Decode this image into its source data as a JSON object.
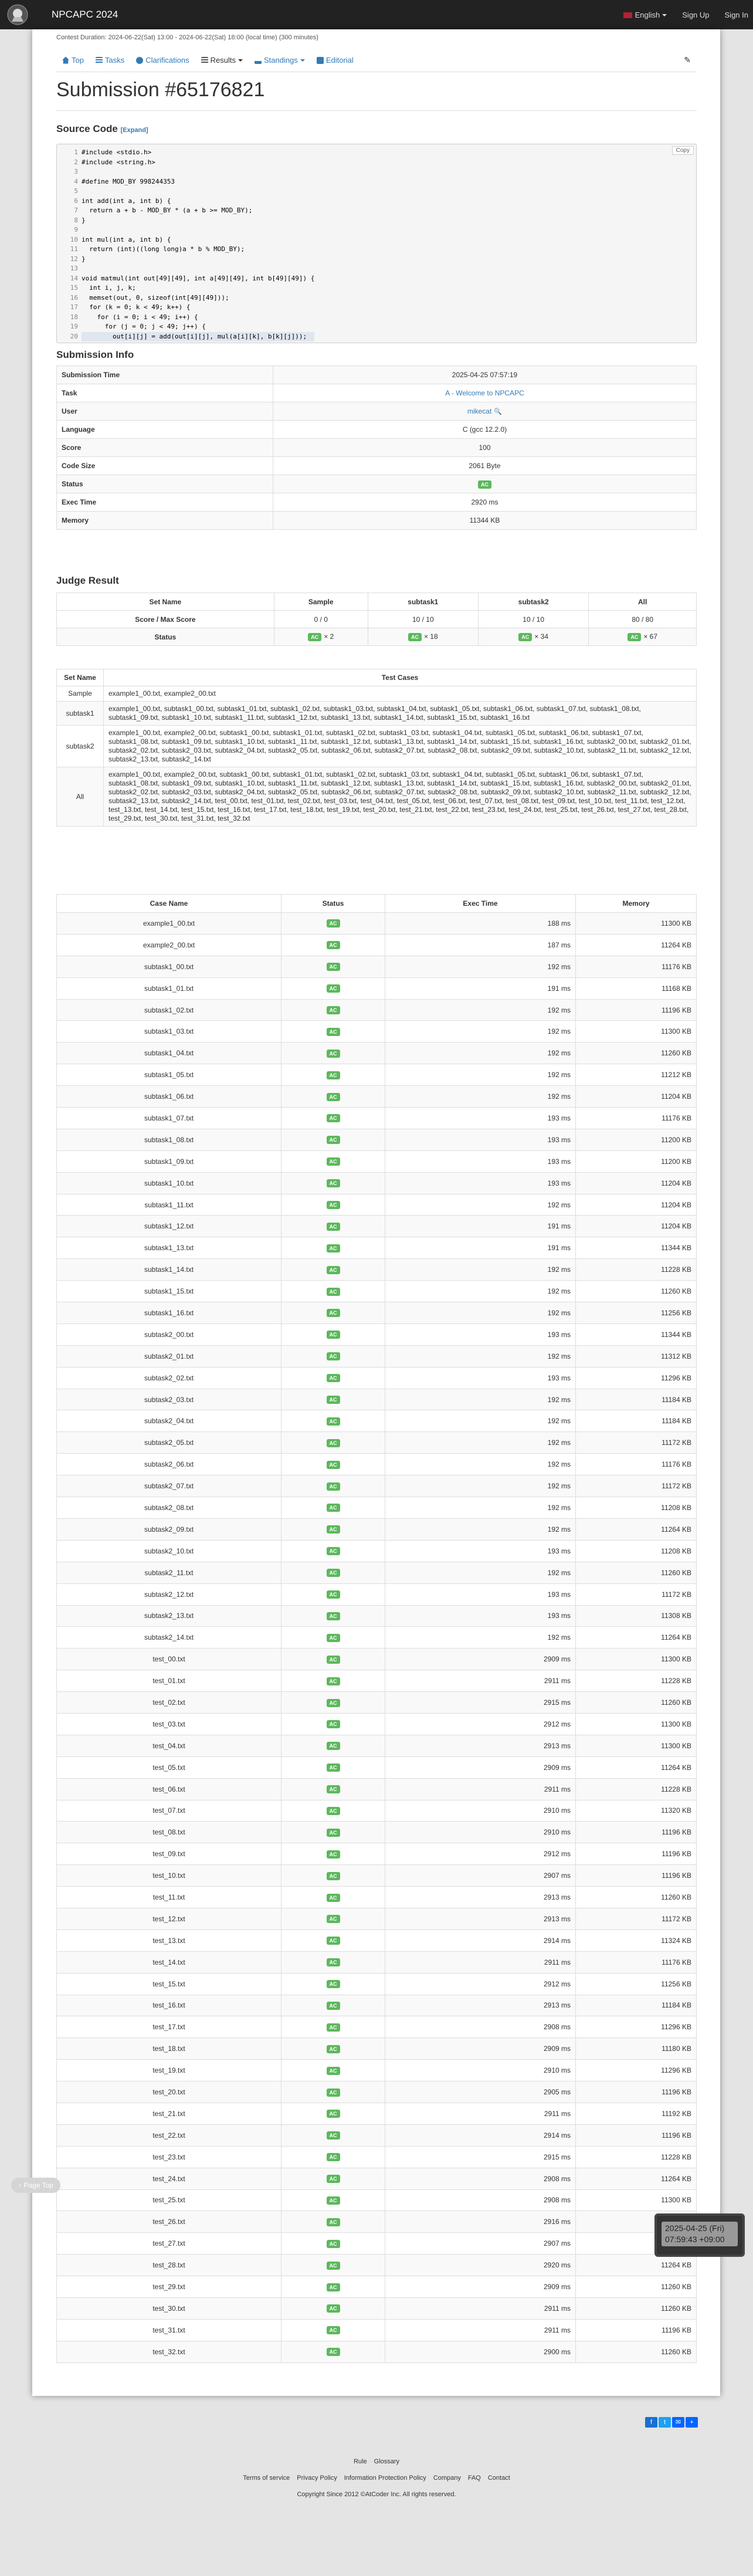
{
  "header": {
    "brand": "NPCAPC 2024",
    "language": "English",
    "sign_up": "Sign Up",
    "sign_in": "Sign In"
  },
  "contest_duration": "Contest Duration: 2024-06-22(Sat) 13:00 - 2024-06-22(Sat) 18:00 (local time) (300 minutes)",
  "tabs": {
    "top": "Top",
    "tasks": "Tasks",
    "clarifications": "Clarifications",
    "results": "Results",
    "standings": "Standings",
    "editorial": "Editorial"
  },
  "title": "Submission #65176821",
  "source": {
    "heading": "Source Code",
    "expand": "[Expand]",
    "copy": "Copy",
    "lines": [
      "#include <stdio.h>",
      "#include <string.h>",
      "",
      "#define MOD_BY 998244353",
      "",
      "int add(int a, int b) {",
      "  return a + b - MOD_BY * (a + b >= MOD_BY);",
      "}",
      "",
      "int mul(int a, int b) {",
      "  return (int)((long long)a * b % MOD_BY);",
      "}",
      "",
      "void matmul(int out[49][49], int a[49][49], int b[49][49]) {",
      "  int i, j, k;",
      "  memset(out, 0, sizeof(int[49][49]));",
      "  for (k = 0; k < 49; k++) {",
      "    for (i = 0; i < 49; i++) {",
      "      for (j = 0; j < 49; j++) {",
      "        out[i][j] = add(out[i][j], mul(a[i][k], b[k][j]));"
    ]
  },
  "info": {
    "heading": "Submission Info",
    "rows": [
      {
        "key": "Submission Time",
        "value": "2025-04-25 07:57:19"
      },
      {
        "key": "Task",
        "value": "A - Welcome to NPCAPC"
      },
      {
        "key": "User",
        "value": "mikecat"
      },
      {
        "key": "Language",
        "value": "C (gcc 12.2.0)"
      },
      {
        "key": "Score",
        "value": "100"
      },
      {
        "key": "Code Size",
        "value": "2061 Byte"
      },
      {
        "key": "Status",
        "value": "AC"
      },
      {
        "key": "Exec Time",
        "value": "2920 ms"
      },
      {
        "key": "Memory",
        "value": "11344 KB"
      }
    ]
  },
  "judge": {
    "heading": "Judge Result",
    "headers": [
      "Set Name",
      "Sample",
      "subtask1",
      "subtask2",
      "All"
    ],
    "score_label": "Score / Max Score",
    "scores": [
      "0 / 0",
      "10 / 10",
      "10 / 10",
      "80 / 80"
    ],
    "status_label": "Status",
    "status": [
      {
        "badge": "AC",
        "count": "× 2"
      },
      {
        "badge": "AC",
        "count": "× 18"
      },
      {
        "badge": "AC",
        "count": "× 34"
      },
      {
        "badge": "AC",
        "count": "× 67"
      }
    ]
  },
  "sets": {
    "headers": [
      "Set Name",
      "Test Cases"
    ],
    "rows": [
      {
        "name": "Sample",
        "cases": "example1_00.txt, example2_00.txt"
      },
      {
        "name": "subtask1",
        "cases": "example1_00.txt, subtask1_00.txt, subtask1_01.txt, subtask1_02.txt, subtask1_03.txt, subtask1_04.txt, subtask1_05.txt, subtask1_06.txt, subtask1_07.txt, subtask1_08.txt, subtask1_09.txt, subtask1_10.txt, subtask1_11.txt, subtask1_12.txt, subtask1_13.txt, subtask1_14.txt, subtask1_15.txt, subtask1_16.txt"
      },
      {
        "name": "subtask2",
        "cases": "example1_00.txt, example2_00.txt, subtask1_00.txt, subtask1_01.txt, subtask1_02.txt, subtask1_03.txt, subtask1_04.txt, subtask1_05.txt, subtask1_06.txt, subtask1_07.txt, subtask1_08.txt, subtask1_09.txt, subtask1_10.txt, subtask1_11.txt, subtask1_12.txt, subtask1_13.txt, subtask1_14.txt, subtask1_15.txt, subtask1_16.txt, subtask2_00.txt, subtask2_01.txt, subtask2_02.txt, subtask2_03.txt, subtask2_04.txt, subtask2_05.txt, subtask2_06.txt, subtask2_07.txt, subtask2_08.txt, subtask2_09.txt, subtask2_10.txt, subtask2_11.txt, subtask2_12.txt, subtask2_13.txt, subtask2_14.txt"
      },
      {
        "name": "All",
        "cases": "example1_00.txt, example2_00.txt, subtask1_00.txt, subtask1_01.txt, subtask1_02.txt, subtask1_03.txt, subtask1_04.txt, subtask1_05.txt, subtask1_06.txt, subtask1_07.txt, subtask1_08.txt, subtask1_09.txt, subtask1_10.txt, subtask1_11.txt, subtask1_12.txt, subtask1_13.txt, subtask1_14.txt, subtask1_15.txt, subtask1_16.txt, subtask2_00.txt, subtask2_01.txt, subtask2_02.txt, subtask2_03.txt, subtask2_04.txt, subtask2_05.txt, subtask2_06.txt, subtask2_07.txt, subtask2_08.txt, subtask2_09.txt, subtask2_10.txt, subtask2_11.txt, subtask2_12.txt, subtask2_13.txt, subtask2_14.txt, test_00.txt, test_01.txt, test_02.txt, test_03.txt, test_04.txt, test_05.txt, test_06.txt, test_07.txt, test_08.txt, test_09.txt, test_10.txt, test_11.txt, test_12.txt, test_13.txt, test_14.txt, test_15.txt, test_16.txt, test_17.txt, test_18.txt, test_19.txt, test_20.txt, test_21.txt, test_22.txt, test_23.txt, test_24.txt, test_25.txt, test_26.txt, test_27.txt, test_28.txt, test_29.txt, test_30.txt, test_31.txt, test_32.txt"
      }
    ]
  },
  "cases": {
    "headers": [
      "Case Name",
      "Status",
      "Exec Time",
      "Memory"
    ],
    "rows": [
      [
        "example1_00.txt",
        "AC",
        "188 ms",
        "11300 KB"
      ],
      [
        "example2_00.txt",
        "AC",
        "187 ms",
        "11264 KB"
      ],
      [
        "subtask1_00.txt",
        "AC",
        "192 ms",
        "11176 KB"
      ],
      [
        "subtask1_01.txt",
        "AC",
        "191 ms",
        "11168 KB"
      ],
      [
        "subtask1_02.txt",
        "AC",
        "192 ms",
        "11196 KB"
      ],
      [
        "subtask1_03.txt",
        "AC",
        "192 ms",
        "11300 KB"
      ],
      [
        "subtask1_04.txt",
        "AC",
        "192 ms",
        "11260 KB"
      ],
      [
        "subtask1_05.txt",
        "AC",
        "192 ms",
        "11212 KB"
      ],
      [
        "subtask1_06.txt",
        "AC",
        "192 ms",
        "11204 KB"
      ],
      [
        "subtask1_07.txt",
        "AC",
        "193 ms",
        "11176 KB"
      ],
      [
        "subtask1_08.txt",
        "AC",
        "193 ms",
        "11200 KB"
      ],
      [
        "subtask1_09.txt",
        "AC",
        "193 ms",
        "11200 KB"
      ],
      [
        "subtask1_10.txt",
        "AC",
        "193 ms",
        "11204 KB"
      ],
      [
        "subtask1_11.txt",
        "AC",
        "192 ms",
        "11204 KB"
      ],
      [
        "subtask1_12.txt",
        "AC",
        "191 ms",
        "11204 KB"
      ],
      [
        "subtask1_13.txt",
        "AC",
        "191 ms",
        "11344 KB"
      ],
      [
        "subtask1_14.txt",
        "AC",
        "192 ms",
        "11228 KB"
      ],
      [
        "subtask1_15.txt",
        "AC",
        "192 ms",
        "11260 KB"
      ],
      [
        "subtask1_16.txt",
        "AC",
        "192 ms",
        "11256 KB"
      ],
      [
        "subtask2_00.txt",
        "AC",
        "193 ms",
        "11344 KB"
      ],
      [
        "subtask2_01.txt",
        "AC",
        "192 ms",
        "11312 KB"
      ],
      [
        "subtask2_02.txt",
        "AC",
        "193 ms",
        "11296 KB"
      ],
      [
        "subtask2_03.txt",
        "AC",
        "192 ms",
        "11184 KB"
      ],
      [
        "subtask2_04.txt",
        "AC",
        "192 ms",
        "11184 KB"
      ],
      [
        "subtask2_05.txt",
        "AC",
        "192 ms",
        "11172 KB"
      ],
      [
        "subtask2_06.txt",
        "AC",
        "192 ms",
        "11176 KB"
      ],
      [
        "subtask2_07.txt",
        "AC",
        "192 ms",
        "11172 KB"
      ],
      [
        "subtask2_08.txt",
        "AC",
        "192 ms",
        "11208 KB"
      ],
      [
        "subtask2_09.txt",
        "AC",
        "192 ms",
        "11264 KB"
      ],
      [
        "subtask2_10.txt",
        "AC",
        "193 ms",
        "11208 KB"
      ],
      [
        "subtask2_11.txt",
        "AC",
        "192 ms",
        "11260 KB"
      ],
      [
        "subtask2_12.txt",
        "AC",
        "193 ms",
        "11172 KB"
      ],
      [
        "subtask2_13.txt",
        "AC",
        "193 ms",
        "11308 KB"
      ],
      [
        "subtask2_14.txt",
        "AC",
        "192 ms",
        "11264 KB"
      ],
      [
        "test_00.txt",
        "AC",
        "2909 ms",
        "11300 KB"
      ],
      [
        "test_01.txt",
        "AC",
        "2911 ms",
        "11228 KB"
      ],
      [
        "test_02.txt",
        "AC",
        "2915 ms",
        "11260 KB"
      ],
      [
        "test_03.txt",
        "AC",
        "2912 ms",
        "11300 KB"
      ],
      [
        "test_04.txt",
        "AC",
        "2913 ms",
        "11300 KB"
      ],
      [
        "test_05.txt",
        "AC",
        "2909 ms",
        "11264 KB"
      ],
      [
        "test_06.txt",
        "AC",
        "2911 ms",
        "11228 KB"
      ],
      [
        "test_07.txt",
        "AC",
        "2910 ms",
        "11320 KB"
      ],
      [
        "test_08.txt",
        "AC",
        "2910 ms",
        "11196 KB"
      ],
      [
        "test_09.txt",
        "AC",
        "2912 ms",
        "11196 KB"
      ],
      [
        "test_10.txt",
        "AC",
        "2907 ms",
        "11196 KB"
      ],
      [
        "test_11.txt",
        "AC",
        "2913 ms",
        "11260 KB"
      ],
      [
        "test_12.txt",
        "AC",
        "2913 ms",
        "11172 KB"
      ],
      [
        "test_13.txt",
        "AC",
        "2914 ms",
        "11324 KB"
      ],
      [
        "test_14.txt",
        "AC",
        "2911 ms",
        "11176 KB"
      ],
      [
        "test_15.txt",
        "AC",
        "2912 ms",
        "11256 KB"
      ],
      [
        "test_16.txt",
        "AC",
        "2913 ms",
        "11184 KB"
      ],
      [
        "test_17.txt",
        "AC",
        "2908 ms",
        "11296 KB"
      ],
      [
        "test_18.txt",
        "AC",
        "2909 ms",
        "11180 KB"
      ],
      [
        "test_19.txt",
        "AC",
        "2910 ms",
        "11296 KB"
      ],
      [
        "test_20.txt",
        "AC",
        "2905 ms",
        "11196 KB"
      ],
      [
        "test_21.txt",
        "AC",
        "2911 ms",
        "11192 KB"
      ],
      [
        "test_22.txt",
        "AC",
        "2914 ms",
        "11196 KB"
      ],
      [
        "test_23.txt",
        "AC",
        "2915 ms",
        "11228 KB"
      ],
      [
        "test_24.txt",
        "AC",
        "2908 ms",
        "11264 KB"
      ],
      [
        "test_25.txt",
        "AC",
        "2908 ms",
        "11300 KB"
      ],
      [
        "test_26.txt",
        "AC",
        "2916 ms",
        "11300 KB"
      ],
      [
        "test_27.txt",
        "AC",
        "2907 ms",
        "11316 KB"
      ],
      [
        "test_28.txt",
        "AC",
        "2920 ms",
        "11264 KB"
      ],
      [
        "test_29.txt",
        "AC",
        "2909 ms",
        "11260 KB"
      ],
      [
        "test_30.txt",
        "AC",
        "2911 ms",
        "11260 KB"
      ],
      [
        "test_31.txt",
        "AC",
        "2911 ms",
        "11196 KB"
      ],
      [
        "test_32.txt",
        "AC",
        "2900 ms",
        "11260 KB"
      ]
    ]
  },
  "page_top": "Page Top",
  "tooltip": {
    "line1": "2025-04-25 (Fri)",
    "line2": "07:59:43 +09:00"
  },
  "footer": {
    "links1": [
      "Rule",
      "Glossary"
    ],
    "links2": [
      "Terms of service",
      "Privacy Policy",
      "Information Protection Policy",
      "Company",
      "FAQ",
      "Contact"
    ],
    "copyright": "Copyright Since 2012 ©AtCoder Inc. All rights reserved."
  },
  "colors": {
    "ac": "#5cb85c",
    "navbar": "#222222",
    "link": "#337ab7"
  },
  "icons": [
    "home-icon",
    "list-icon",
    "comment-icon",
    "results-icon",
    "standings-icon",
    "book-icon",
    "pencil-icon",
    "search-icon"
  ]
}
